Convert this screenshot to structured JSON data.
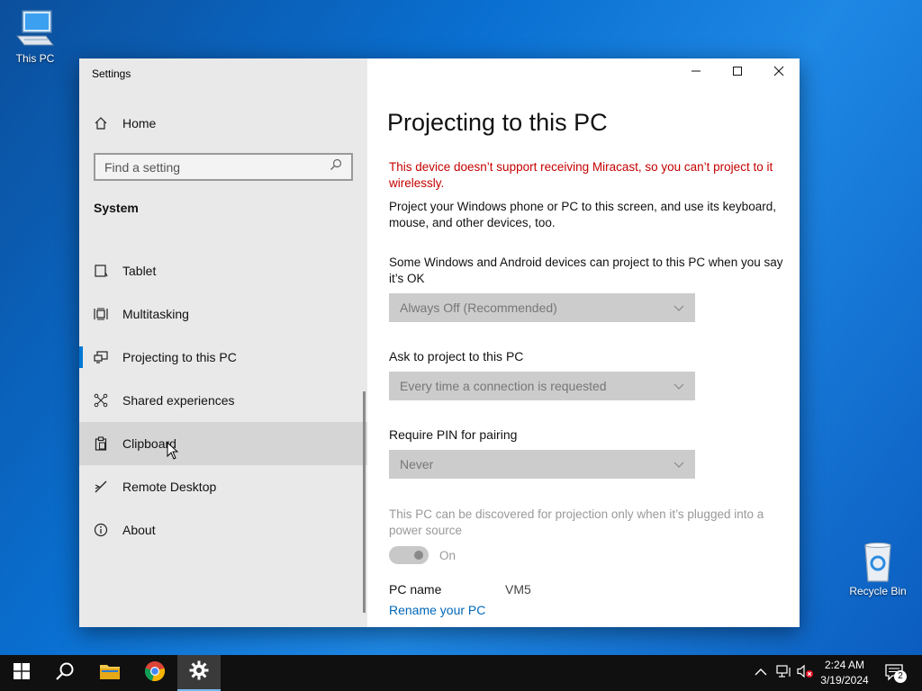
{
  "desktop": {
    "icons": [
      {
        "label": "This PC",
        "icon": "computer-icon"
      },
      {
        "label": "Recycle Bin",
        "icon": "recycle-bin-icon"
      }
    ]
  },
  "window": {
    "title": "Settings",
    "caption": {
      "minimize": "minimize-icon",
      "maximize": "maximize-icon",
      "close": "close-icon"
    }
  },
  "sidebar": {
    "home_label": "Home",
    "search_placeholder": "Find a setting",
    "section": "System",
    "items": [
      {
        "label": "Tablet",
        "icon": "tablet-icon"
      },
      {
        "label": "Multitasking",
        "icon": "multitasking-icon"
      },
      {
        "label": "Projecting to this PC",
        "icon": "projecting-icon",
        "selected": true
      },
      {
        "label": "Shared experiences",
        "icon": "shared-experiences-icon"
      },
      {
        "label": "Clipboard",
        "icon": "clipboard-icon",
        "hover": true
      },
      {
        "label": "Remote Desktop",
        "icon": "remote-desktop-icon"
      },
      {
        "label": "About",
        "icon": "info-icon"
      }
    ]
  },
  "content": {
    "title": "Projecting to this PC",
    "warning": "This device doesn’t support receiving Miracast, so you can’t project to it wirelessly.",
    "description": "Project your Windows phone or PC to this screen, and use its keyboard, mouse, and other devices, too.",
    "setting1": {
      "label": "Some Windows and Android devices can project to this PC when you say it’s OK",
      "value": "Always Off (Recommended)"
    },
    "setting2": {
      "label": "Ask to project to this PC",
      "value": "Every time a connection is requested"
    },
    "setting3": {
      "label": "Require PIN for pairing",
      "value": "Never"
    },
    "power_note": "This PC can be discovered for projection only when it’s plugged into a power source",
    "toggle_label": "On",
    "pc_name_label": "PC name",
    "pc_name_value": "VM5",
    "rename_link": "Rename your PC"
  },
  "taskbar": {
    "time": "2:24 AM",
    "date": "3/19/2024",
    "notification_count": "2"
  },
  "colors": {
    "accent": "#0078d7",
    "warning": "#c50000",
    "link": "#0067b8"
  }
}
